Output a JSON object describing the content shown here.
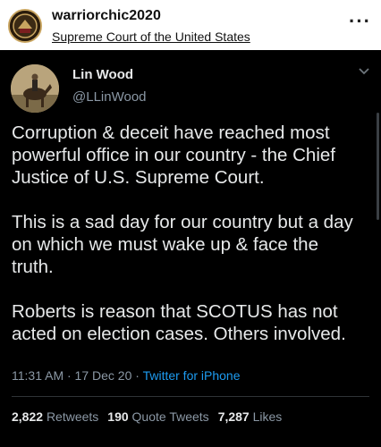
{
  "post": {
    "username": "warriorchic2020",
    "location": "Supreme Court of the United States",
    "more_icon": "more-dots-icon"
  },
  "tweet": {
    "name": "Lin Wood",
    "handle": "@LLinWood",
    "paragraphs": [
      [
        "Corruption & deceit have reached most",
        "powerful office in our country - the Chief",
        "Justice of U.S. Supreme Court."
      ],
      [
        "This is a sad day for our country but a day",
        "on which we must wake up & face the",
        "truth."
      ],
      [
        "Roberts is reason that SCOTUS has not",
        "acted on election cases. Others involved."
      ]
    ],
    "time": "11:31 AM · 17 Dec 20 · ",
    "source": "Twitter for iPhone",
    "stats": {
      "retweets_count": "2,822",
      "retweets_label": "Retweets",
      "quotes_count": "190",
      "quotes_label": "Quote Tweets",
      "likes_count": "7,287",
      "likes_label": "Likes"
    },
    "colors": {
      "background": "#000000",
      "text": "#e7e9ea",
      "muted": "#8b98a5",
      "link": "#1d9bf0"
    }
  }
}
